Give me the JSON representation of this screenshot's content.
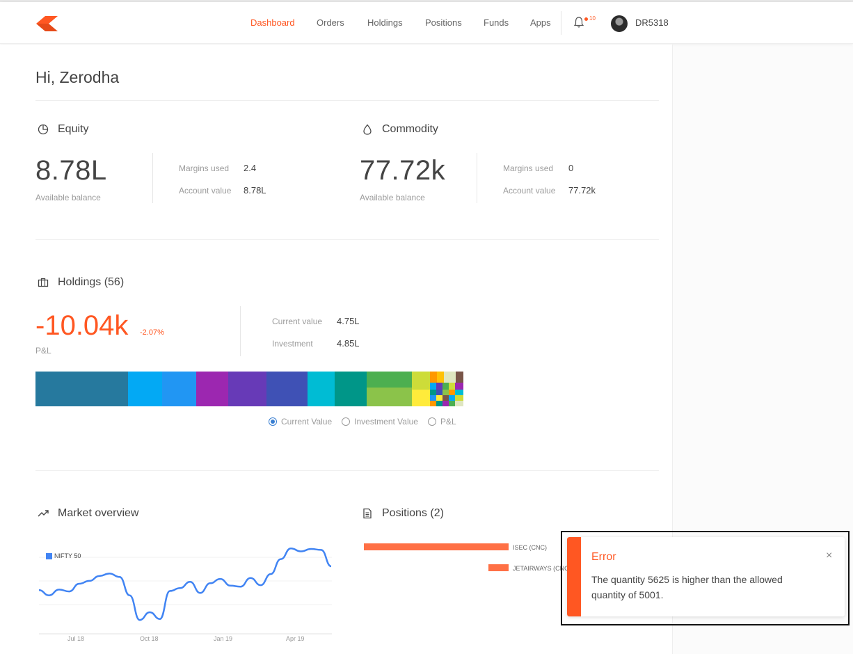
{
  "colors": {
    "accent": "#ff5722",
    "blue": "#387ed1",
    "line": "#4184f3",
    "bar": "#ff7045"
  },
  "header": {
    "nav": [
      {
        "label": "Dashboard",
        "active": true
      },
      {
        "label": "Orders"
      },
      {
        "label": "Holdings"
      },
      {
        "label": "Positions"
      },
      {
        "label": "Funds"
      },
      {
        "label": "Apps"
      }
    ],
    "notification_count": "10",
    "user_id": "DR5318",
    "icons": [
      "kite-logo-icon",
      "bell-icon",
      "avatar"
    ]
  },
  "greeting": "Hi, Zerodha",
  "equity": {
    "title": "Equity",
    "icon": "pie-chart-icon",
    "balance": "8.78L",
    "balance_label": "Available balance",
    "margins_used_label": "Margins used",
    "margins_used": "2.4",
    "account_value_label": "Account value",
    "account_value": "8.78L"
  },
  "commodity": {
    "title": "Commodity",
    "icon": "drop-icon",
    "balance": "77.72k",
    "balance_label": "Available balance",
    "margins_used_label": "Margins used",
    "margins_used": "0",
    "account_value_label": "Account value",
    "account_value": "77.72k"
  },
  "holdings": {
    "title": "Holdings (56)",
    "icon": "briefcase-icon",
    "pnl": "-10.04k",
    "pnl_pct": "-2.07%",
    "pnl_label": "P&L",
    "current_value_label": "Current value",
    "current_value": "4.75L",
    "investment_label": "Investment",
    "investment": "4.85L",
    "view_options": [
      {
        "label": "Current Value",
        "checked": true
      },
      {
        "label": "Investment Value",
        "checked": false
      },
      {
        "label": "P&L",
        "checked": false
      }
    ],
    "treemap_colors": [
      "#26799e",
      "#03a9f4",
      "#2196f3",
      "#9c27b0",
      "#673ab7",
      "#3f51b5",
      "#00bcd4",
      "#009688",
      "#4caf50",
      "#8bc34a",
      "#cddc39",
      "#ffeb3b",
      "#ff9800",
      "#795548"
    ]
  },
  "market_overview": {
    "title": "Market overview",
    "icon": "trending-up-icon"
  },
  "positions": {
    "title": "Positions (2)",
    "icon": "document-icon"
  },
  "chart_data": [
    {
      "type": "line",
      "series": [
        {
          "name": "NIFTY 50",
          "values": [
            10720,
            10610,
            10730,
            10690,
            10850,
            10910,
            11010,
            11060,
            10990,
            10610,
            10100,
            10260,
            10120,
            10700,
            10760,
            10890,
            10660,
            10860,
            10950,
            10810,
            10790,
            10970,
            10820,
            11050,
            11360,
            11580,
            11520,
            11570,
            11550,
            11210
          ]
        }
      ],
      "x_ticks": [
        "Jul 18",
        "Oct 18",
        "Jan 19",
        "Apr 19"
      ],
      "grid": true,
      "legend": "top-left"
    },
    {
      "type": "bar",
      "orientation": "horizontal",
      "categories": [
        "ISEC (CNC)",
        "JETAIRWAYS (CNC)"
      ],
      "category_labels_shown": [
        "ISEC (CNC)",
        "JETAIRWAYS (CNC"
      ],
      "values": [
        -100,
        -14
      ],
      "grid": false
    }
  ],
  "toast": {
    "title": "Error",
    "message": "The quantity 5625 is higher than the allowed quantity of 5001.",
    "close": "×"
  }
}
